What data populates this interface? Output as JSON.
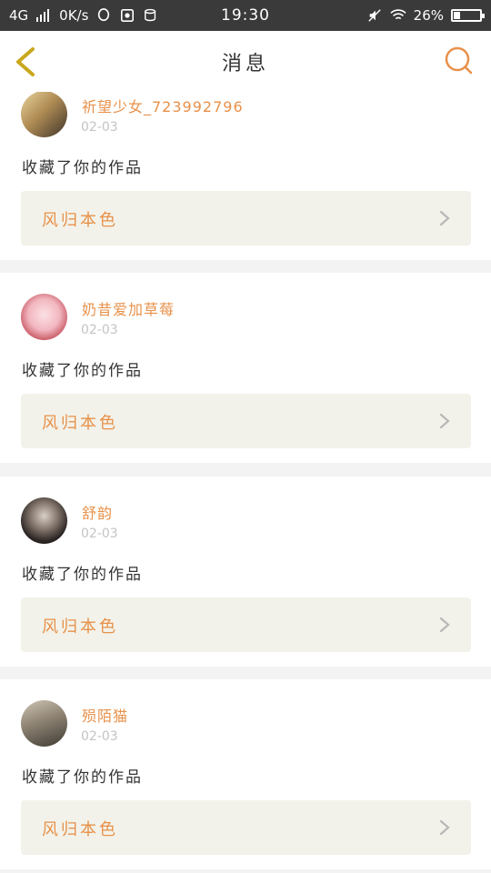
{
  "status_bar": {
    "network": "4G",
    "speed": "0K/s",
    "time": "19:30",
    "battery": "26%",
    "battery_level": 0.26
  },
  "header": {
    "title": "消息",
    "back_icon": "chevron-left-icon",
    "search_icon": "search-icon"
  },
  "colors": {
    "accent": "#e8914a",
    "back": "#c9a71d",
    "card_link_bg": "#f2f2ea"
  },
  "notifications": [
    {
      "username": "祈望少女_723992796",
      "date": "02-03",
      "action": "收藏了你的作品",
      "work_title": "风归本色"
    },
    {
      "username": "奶昔爱加草莓",
      "date": "02-03",
      "action": "收藏了你的作品",
      "work_title": "风归本色"
    },
    {
      "username": "舒韵",
      "date": "02-03",
      "action": "收藏了你的作品",
      "work_title": "风归本色"
    },
    {
      "username": "殒陌猫",
      "date": "02-03",
      "action": "收藏了你的作品",
      "work_title": "风归本色"
    }
  ]
}
